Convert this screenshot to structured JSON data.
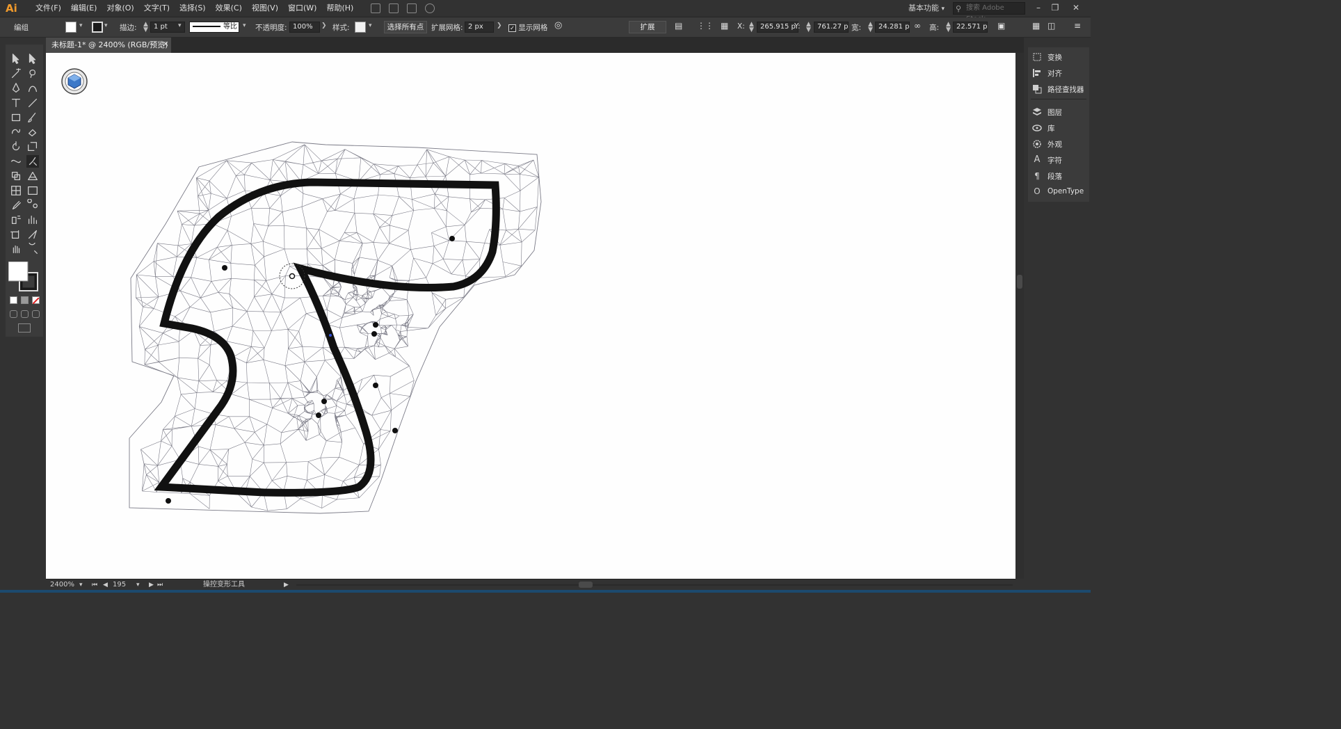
{
  "app": {
    "logo": "Ai"
  },
  "menu": {
    "items": [
      "文件(F)",
      "编辑(E)",
      "对象(O)",
      "文字(T)",
      "选择(S)",
      "效果(C)",
      "视图(V)",
      "窗口(W)",
      "帮助(H)"
    ],
    "workspace": "基本功能",
    "search_placeholder": "搜索 Adobe Stock"
  },
  "controlbar": {
    "mode_label": "编组",
    "stroke_label": "描边:",
    "stroke_value": "1 pt",
    "stroke_profile": "等比",
    "opacity_label": "不透明度:",
    "opacity_value": "100%",
    "style_label": "样式:",
    "select_all_points": "选择所有点",
    "expand_mesh_label": "扩展网格:",
    "expand_mesh_value": "2 px",
    "show_mesh_label": "显示网格",
    "expand_button": "扩展",
    "x_label": "X:",
    "x_value": "265.915 p",
    "y_label": "Y:",
    "y_value": "761.27 p",
    "w_label": "宽:",
    "w_value": "24.281 p",
    "h_label": "高:",
    "h_value": "22.571 p"
  },
  "document": {
    "tab_title": "未标题-1* @ 2400% (RGB/预览)"
  },
  "statusbar": {
    "zoom": "2400%",
    "page": "195",
    "tool_name": "操控变形工具"
  },
  "right_panels": {
    "items": [
      "变换",
      "对齐",
      "路径查找器",
      "图层",
      "库",
      "外观",
      "字符",
      "段落",
      "OpenType"
    ]
  },
  "colors": {
    "accent_logo": "#f09a2c",
    "mesh_line": "#7a7a86",
    "shape_stroke": "#111111",
    "pin_color": "#0f0f0f"
  }
}
